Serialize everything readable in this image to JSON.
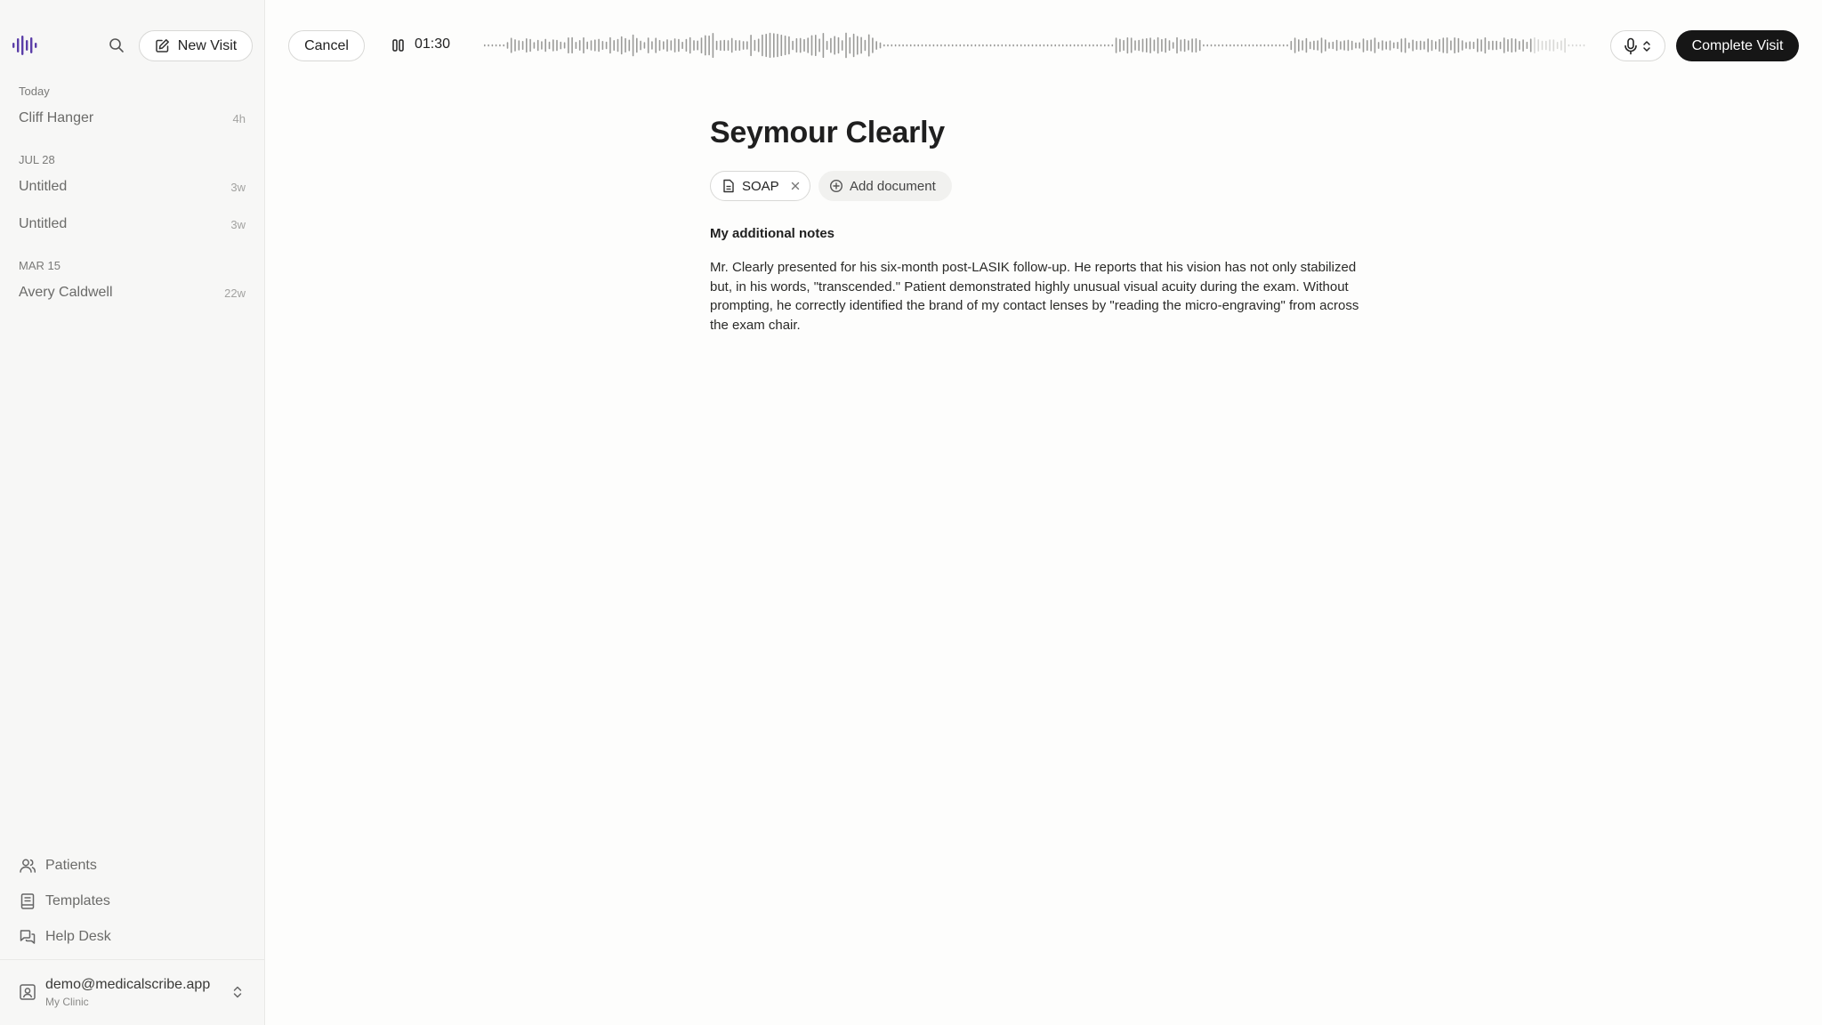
{
  "sidebar": {
    "new_visit_label": "New Visit",
    "groups": [
      {
        "label": "Today",
        "items": [
          {
            "name": "Cliff Hanger",
            "age": "4h"
          }
        ]
      },
      {
        "label": "JUL 28",
        "items": [
          {
            "name": "Untitled",
            "age": "3w"
          },
          {
            "name": "Untitled",
            "age": "3w"
          }
        ]
      },
      {
        "label": "MAR 15",
        "items": [
          {
            "name": "Avery Caldwell",
            "age": "22w"
          }
        ]
      }
    ],
    "nav": [
      {
        "label": "Patients",
        "icon": "users-icon"
      },
      {
        "label": "Templates",
        "icon": "book-icon"
      },
      {
        "label": "Help Desk",
        "icon": "chat-icon"
      }
    ],
    "account": {
      "email": "demo@medicalscribe.app",
      "clinic": "My Clinic"
    }
  },
  "topbar": {
    "cancel_label": "Cancel",
    "timer": "01:30",
    "complete_label": "Complete Visit"
  },
  "visit": {
    "patient_name": "Seymour Clearly",
    "document_chip": "SOAP",
    "add_document_label": "Add document",
    "notes_heading": "My additional notes",
    "notes_text": "Mr. Clearly presented for his six-month post-LASIK follow-up. He reports that his vision has not only stabilized but, in his words, \"transcended.\" Patient demonstrated highly unusual visual acuity during the exam. Without prompting, he correctly identified the brand of my contact lenses by \"reading the micro-engraving\" from across the exam chair."
  },
  "colors": {
    "logo_accent": "#5b3ea8",
    "primary_button": "#161616",
    "sidebar_bg": "#f7f7f6"
  }
}
